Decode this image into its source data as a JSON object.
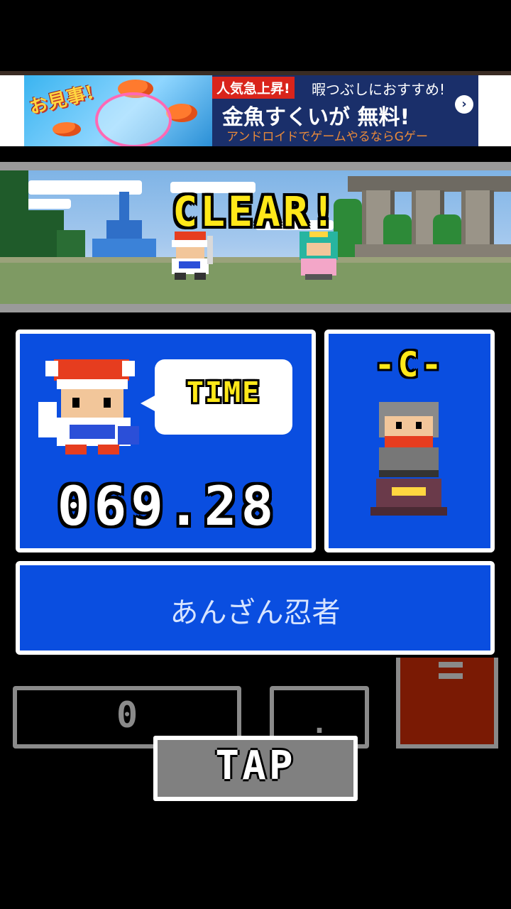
{
  "ad": {
    "praise": "お見事!",
    "hot_badge": "人気急上昇!",
    "recommend": "暇つぶしにおすすめ!",
    "main_title": "金魚すくいが",
    "free_label": "無料!",
    "subtitle": "アンドロイドでゲームやるならGゲー",
    "arrow": "›"
  },
  "scene": {
    "banner": "CLEAR!"
  },
  "result": {
    "time_label": "TIME",
    "time_value": "069.28",
    "rank": "-C-",
    "title": "あんざん忍者"
  },
  "controls": {
    "counter_value": "0",
    "dot_value": ".",
    "tap_label": "TAP"
  },
  "colors": {
    "panel_blue": "#0a4ee0",
    "yellow_text": "#ffe819",
    "menu_red": "#7a1a04",
    "button_gray": "#808080"
  },
  "icons": [
    "ninja-hero-icon",
    "princess-icon",
    "ninja-portrait-icon",
    "rank-statue-icon",
    "menu-icon"
  ]
}
